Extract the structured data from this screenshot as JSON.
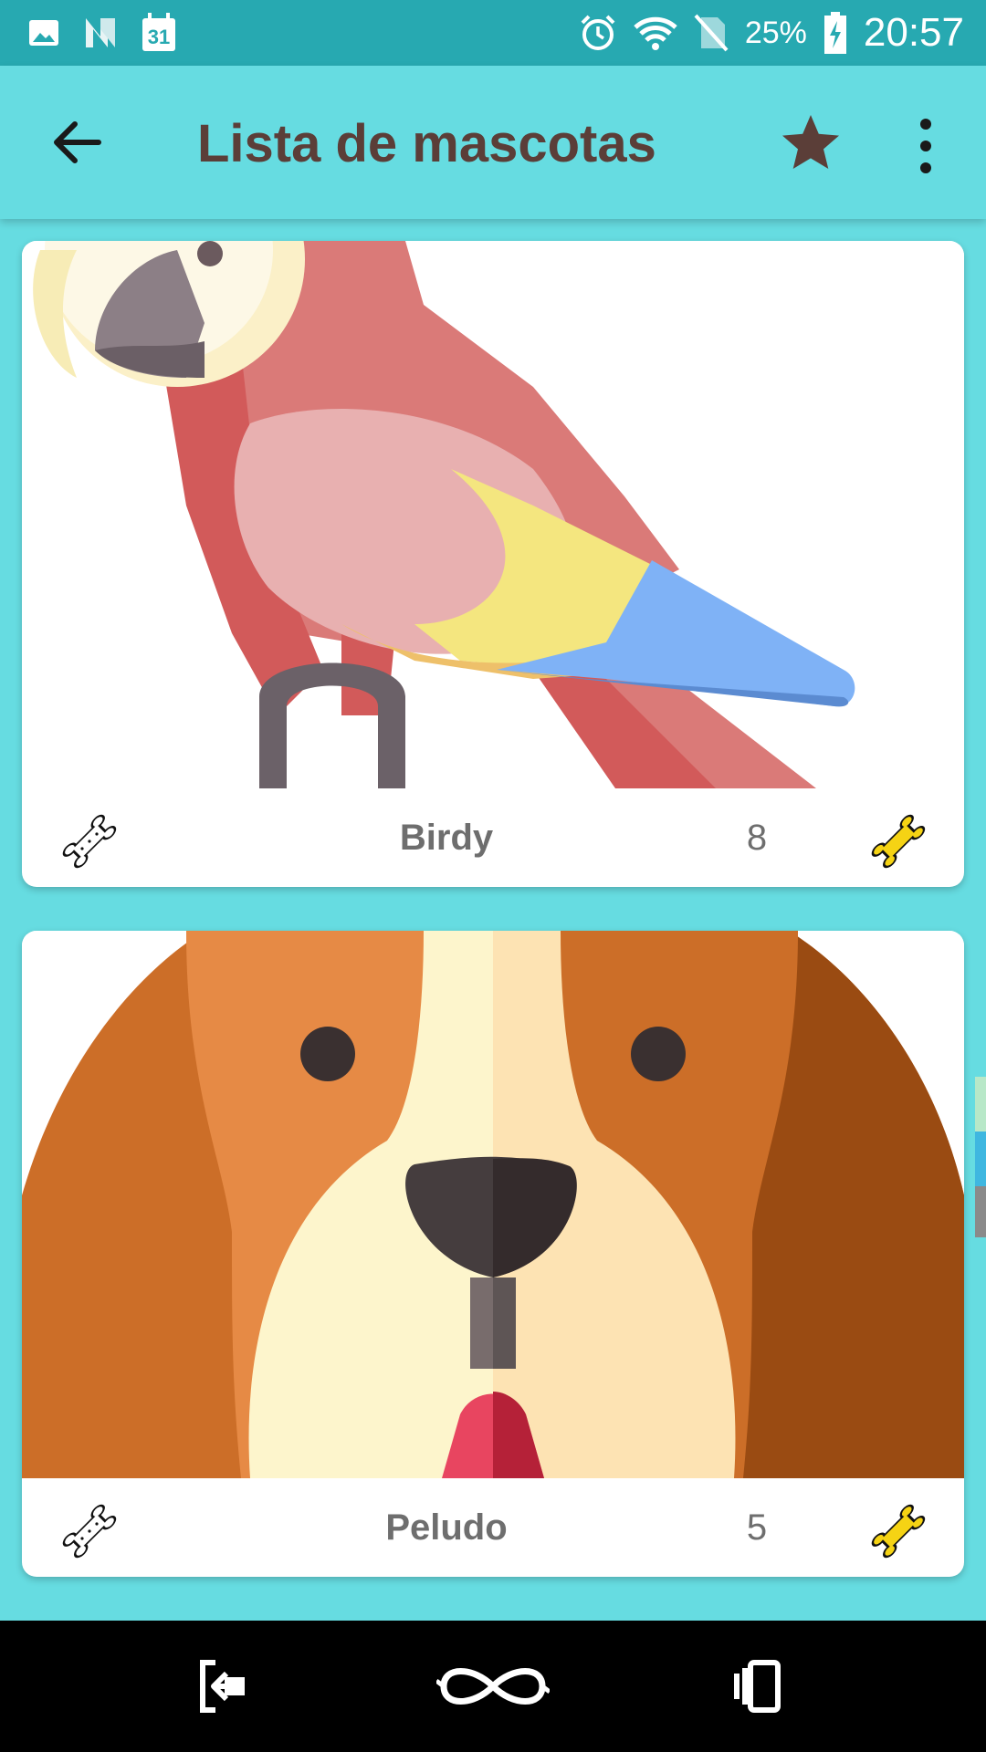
{
  "status_bar": {
    "battery_percent": "25%",
    "time": "20:57",
    "icons": [
      "image-icon",
      "n-icon",
      "calendar-icon",
      "alarm-icon",
      "wifi-icon",
      "no-sim-icon",
      "battery-charging-icon"
    ],
    "calendar_day": "31"
  },
  "app_bar": {
    "title": "Lista de mascotas",
    "icons": [
      "back-arrow-icon",
      "star-icon",
      "more-vert-icon"
    ]
  },
  "pets": [
    {
      "name": "Birdy",
      "count": "8",
      "image": "parrot-illustration"
    },
    {
      "name": "Peludo",
      "count": "5",
      "image": "dog-illustration"
    }
  ],
  "colors": {
    "status_bar": "#27a9b1",
    "app_bar": "#66dce1",
    "title_text": "#5b3e38",
    "bone_active": "#f5d314",
    "nav_bar": "#000000"
  },
  "nav_bar": {
    "icons": [
      "exit-icon",
      "infinity-icon",
      "recent-apps-icon"
    ]
  }
}
